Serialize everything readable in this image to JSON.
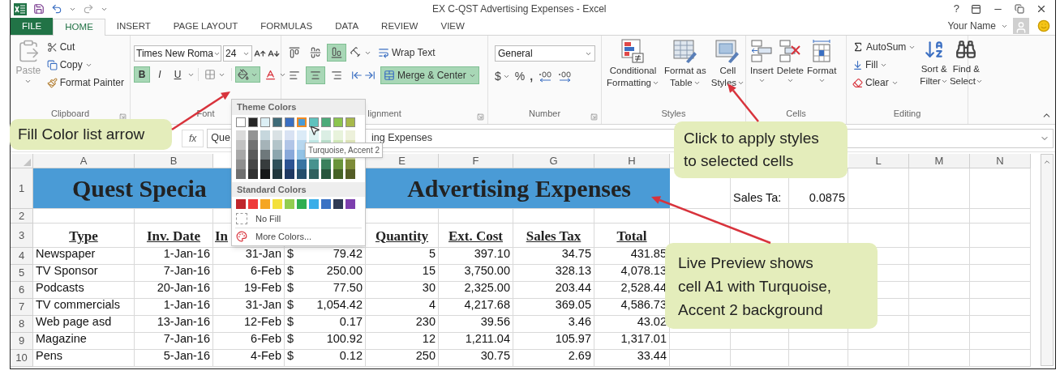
{
  "title_bar": {
    "title": "EX C-QST Advertising Expenses - Excel",
    "help": "?"
  },
  "tabs": [
    {
      "label": "FILE",
      "kind": "file",
      "selected": false
    },
    {
      "label": "HOME",
      "kind": "tab",
      "selected": true
    },
    {
      "label": "INSERT",
      "kind": "tab",
      "selected": false
    },
    {
      "label": "PAGE LAYOUT",
      "kind": "tab",
      "selected": false
    },
    {
      "label": "FORMULAS",
      "kind": "tab",
      "selected": false
    },
    {
      "label": "DATA",
      "kind": "tab",
      "selected": false
    },
    {
      "label": "REVIEW",
      "kind": "tab",
      "selected": false
    },
    {
      "label": "VIEW",
      "kind": "tab",
      "selected": false
    }
  ],
  "account": {
    "name": "Your Name"
  },
  "ribbon": {
    "clipboard": {
      "paste": "Paste",
      "cut": "Cut",
      "copy": "Copy",
      "format_painter": "Format Painter",
      "label": "Clipboard"
    },
    "font": {
      "font_name": "Times New Roma",
      "font_size": "24",
      "bold": {
        "text": "B",
        "on": true
      },
      "italic": {
        "text": "I",
        "on": false
      },
      "underline": {
        "text": "U",
        "on": false
      },
      "fill_color_on": true,
      "label": "Font"
    },
    "alignment": {
      "top_on": false,
      "middle_on": false,
      "bottom_on": true,
      "left_on": false,
      "center_on": true,
      "right_on": false,
      "wrap_text": "Wrap Text",
      "merge": {
        "text": "Merge & Center",
        "on": true
      },
      "label": "lignment"
    },
    "number": {
      "format": "General",
      "currency": "$",
      "percent": "%",
      "comma": ",",
      "label": "Number"
    },
    "styles": {
      "buttons": [
        {
          "lines": [
            "Conditional",
            "Formatting"
          ],
          "kind": "conditional"
        },
        {
          "lines": [
            "Format as",
            "Table"
          ],
          "kind": "table"
        },
        {
          "lines": [
            "Cell",
            "Styles"
          ],
          "kind": "cell_styles"
        }
      ],
      "label": "Styles"
    },
    "cells": {
      "buttons": [
        {
          "text": "Insert",
          "kind": "insert"
        },
        {
          "text": "Delete",
          "kind": "delete"
        },
        {
          "text": "Format",
          "kind": "format"
        }
      ],
      "label": "Cells"
    },
    "editing": {
      "autosum": "AutoSum",
      "fill": "Fill",
      "clear": "Clear",
      "sort": [
        "Sort &",
        "Filter"
      ],
      "find": [
        "Find &",
        "Select"
      ],
      "label": "Editing"
    }
  },
  "formula_bar": {
    "function_symbol": "fx",
    "visible_start": "Que",
    "visible_end": "ing Expenses"
  },
  "columns": [
    {
      "label": "A"
    },
    {
      "label": "B"
    },
    {},
    {},
    {
      "label": "E"
    },
    {
      "label": "F"
    },
    {
      "label": "G"
    },
    {
      "label": "H"
    },
    {},
    {},
    {},
    {
      "label": "L"
    },
    {
      "label": "M"
    },
    {
      "label": "N"
    }
  ],
  "title_row": {
    "number": "1",
    "left": "Quest Specia",
    "right": "Advertising Expenses",
    "j": "Sales Ta:",
    "k": "0.0875"
  },
  "empty_row": {
    "number": "2"
  },
  "header_row": {
    "number": "3",
    "cells": [
      "Type",
      "Inv. Date",
      "In",
      null,
      "Quantity",
      "Ext. Cost",
      "Sales Tax",
      "Total"
    ]
  },
  "rows": [
    {
      "number": "4",
      "type": "Newspaper",
      "inv_date": "1-Jan-16",
      "c": "31-Jan",
      "d_symbol": "$",
      "d_amount": "79.42",
      "quantity": "5",
      "ext_cost": "397.10",
      "sales_tax": "34.75",
      "total": "431.85"
    },
    {
      "number": "5",
      "type": "TV Sponsor",
      "inv_date": "7-Jan-16",
      "c": "6-Feb",
      "d_symbol": "$",
      "d_amount": "250.00",
      "quantity": "15",
      "ext_cost": "3,750.00",
      "sales_tax": "328.13",
      "total": "4,078.13"
    },
    {
      "number": "6",
      "type": "Podcasts",
      "inv_date": "20-Jan-16",
      "c": "19-Feb",
      "d_symbol": "$",
      "d_amount": "77.50",
      "quantity": "30",
      "ext_cost": "2,325.00",
      "sales_tax": "203.44",
      "total": "2,528.44"
    },
    {
      "number": "7",
      "type": "TV commercials",
      "inv_date": "1-Jan-16",
      "c": "31-Jan",
      "d_symbol": "$",
      "d_amount": "1,054.42",
      "quantity": "4",
      "ext_cost": "4,217.68",
      "sales_tax": "369.05",
      "total": "4,586.73"
    },
    {
      "number": "8",
      "type": "Web page asd",
      "inv_date": "13-Jan-16",
      "c": "12-Feb",
      "d_symbol": "$",
      "d_amount": "0.17",
      "quantity": "230",
      "ext_cost": "39.56",
      "sales_tax": "3.46",
      "total": "43.02"
    },
    {
      "number": "9",
      "type": "Magazine",
      "inv_date": "7-Jan-16",
      "c": "6-Feb",
      "d_symbol": "$",
      "d_amount": "100.92",
      "quantity": "12",
      "ext_cost": "1,211.04",
      "sales_tax": "105.97",
      "total": "1,317.01"
    },
    {
      "number": "10",
      "type": "Pens",
      "inv_date": "5-Jan-16",
      "c": "4-Feb",
      "d_symbol": "$",
      "d_amount": "0.12",
      "quantity": "250",
      "ext_cost": "30.75",
      "sales_tax": "2.69",
      "total": "33.44"
    }
  ],
  "color_menu": {
    "theme_heading": "Theme Colors",
    "theme": [
      {
        "color": "#ffffff",
        "hovered": false
      },
      {
        "color": "#262626",
        "hovered": false
      },
      {
        "color": "#dceff5",
        "hovered": false
      },
      {
        "color": "#3f6b78",
        "hovered": false
      },
      {
        "color": "#3b6fc2",
        "hovered": false
      },
      {
        "color": "#4a9bd6",
        "hovered": true
      },
      {
        "color": "#5fc2bd",
        "hovered": false
      },
      {
        "color": "#4dab7a",
        "hovered": false
      },
      {
        "color": "#8cc54e",
        "hovered": false
      },
      {
        "color": "#a7b94b",
        "hovered": false
      }
    ],
    "standard_heading": "Standard Colors",
    "standard": [
      {
        "color": "#c0262c"
      },
      {
        "color": "#ee3b3b"
      },
      {
        "color": "#f5a623"
      },
      {
        "color": "#f3e03b"
      },
      {
        "color": "#92cd50"
      },
      {
        "color": "#2fae52"
      },
      {
        "color": "#3aaee8"
      },
      {
        "color": "#3a72c4"
      },
      {
        "color": "#2e3a55"
      },
      {
        "color": "#7d3fae"
      }
    ],
    "no_fill": "No Fill",
    "more_colors": "More Colors...",
    "tooltip": "Turquoise, Accent 2"
  },
  "callouts": [
    {
      "lines": [
        "Fill Color list arrow"
      ]
    },
    {
      "lines": [
        "Click to apply styles",
        "to selected cells"
      ]
    },
    {
      "lines": [
        "Live Preview shows",
        "cell A1 with Turquoise,",
        "Accent 2 background"
      ]
    }
  ]
}
